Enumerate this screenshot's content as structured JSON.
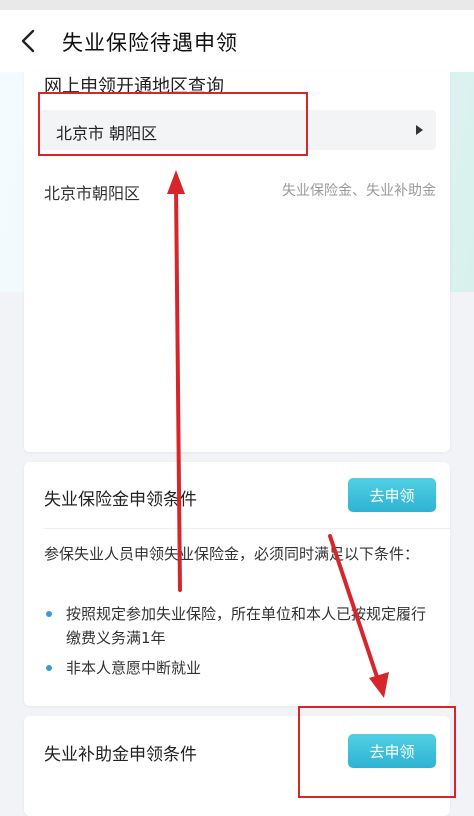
{
  "header": {
    "title": "失业保险待遇申领",
    "back_icon": "chevron-left-icon"
  },
  "region_section": {
    "title": "网上申领开通地区查询",
    "selected_region": "北京市 朝阳区",
    "result_region": "北京市朝阳区",
    "result_benefits": "失业保险金、失业补助金"
  },
  "unemployment_insurance": {
    "title": "失业保险金申领条件",
    "apply_label": "去申领",
    "intro": "参保失业人员申领失业保险金，必须同时满足以下条件：",
    "conditions": [
      "按照规定参加失业保险，所在单位和本人已按规定履行缴费义务满1年",
      "非本人意愿中断就业"
    ]
  },
  "unemployment_subsidy": {
    "title": "失业补助金申领条件",
    "apply_label": "去申领"
  },
  "colors": {
    "accent": "#2fb3d3",
    "annotation": "#d7262a",
    "bullet": "#3b9ad6"
  }
}
